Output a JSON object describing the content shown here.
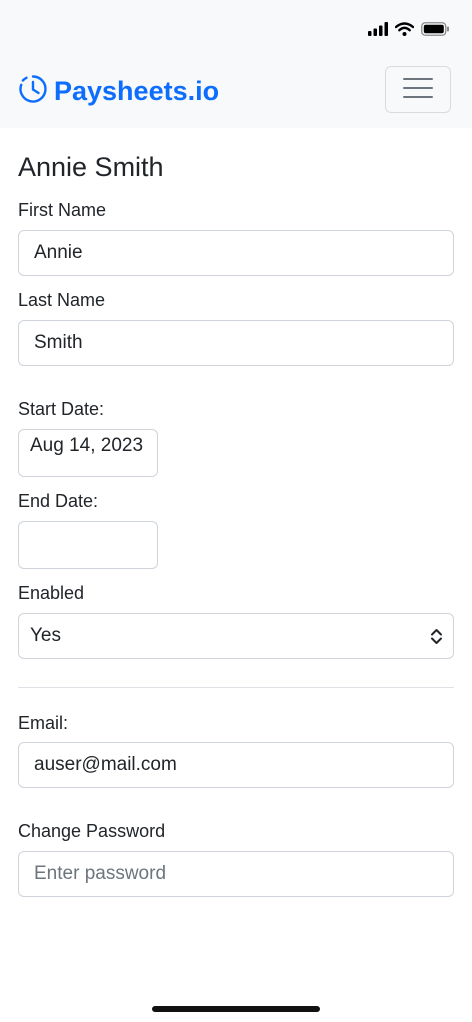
{
  "brand": {
    "name": "Paysheets.io",
    "icon": "clock-icon",
    "color": "#0d6efd"
  },
  "status_bar": {
    "icons": [
      "cellular-signal-icon",
      "wifi-icon",
      "battery-icon"
    ]
  },
  "page": {
    "title": "Annie Smith"
  },
  "form": {
    "first_name": {
      "label": "First Name",
      "value": "Annie"
    },
    "last_name": {
      "label": "Last Name",
      "value": "Smith"
    },
    "start_date": {
      "label": "Start Date:",
      "value": "Aug 14, 2023"
    },
    "end_date": {
      "label": "End Date:",
      "value": ""
    },
    "enabled": {
      "label": "Enabled",
      "value": "Yes"
    },
    "email": {
      "label": "Email:",
      "value": "auser@mail.com"
    },
    "password": {
      "label": "Change Password",
      "placeholder": "Enter password",
      "value": ""
    }
  }
}
